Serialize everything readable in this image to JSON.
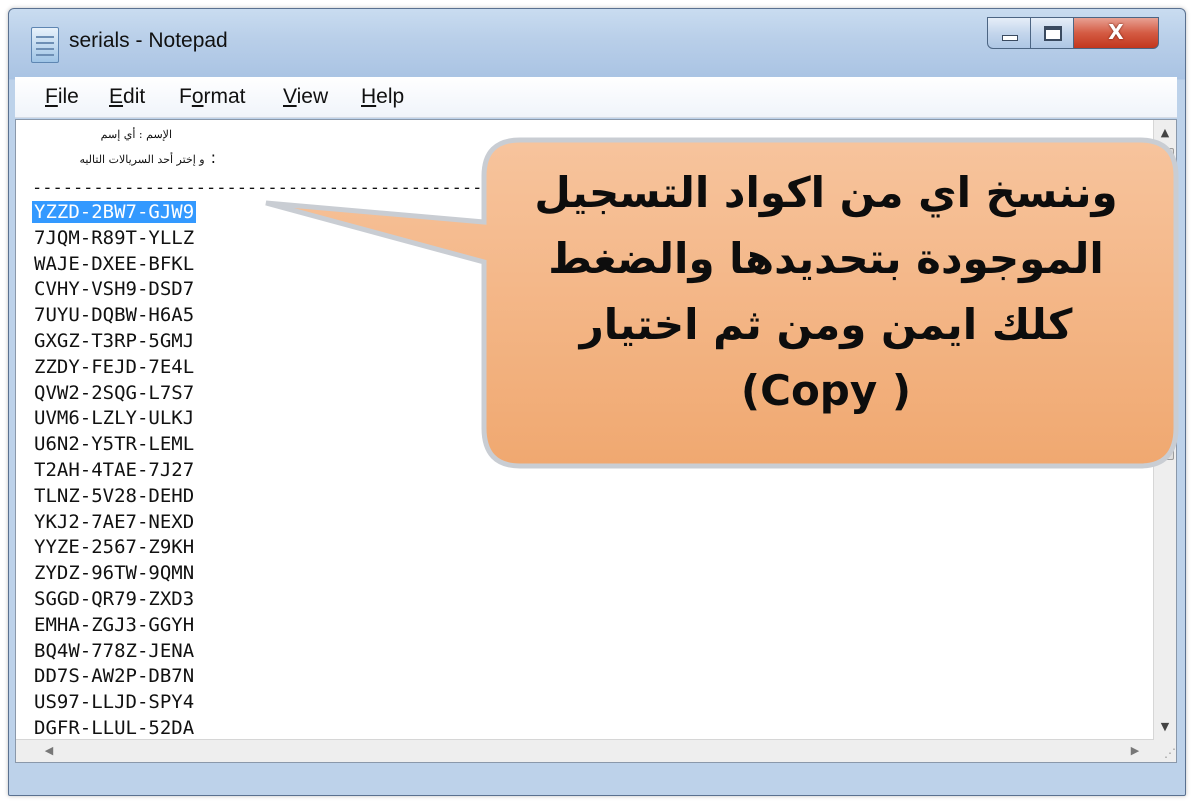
{
  "window": {
    "title": "serials - Notepad",
    "controls": {
      "minimize": "",
      "maximize": "",
      "close": "X"
    }
  },
  "menu": [
    {
      "first": "F",
      "rest": "ile"
    },
    {
      "first": "E",
      "rest": "dit"
    },
    {
      "pre": "F",
      "mid": "o",
      "post": "rmat"
    },
    {
      "first": "V",
      "rest": "iew"
    },
    {
      "first": "H",
      "rest": "elp"
    }
  ],
  "editor": {
    "hint_lines": [
      "الإسم : أي إسم",
      "و إختر أحد السريالات التاليه"
    ],
    "hint_colon": ":",
    "separator": "----------------------------------------------",
    "serials": [
      "YZZD-2BW7-GJW9",
      "7JQM-R89T-YLLZ",
      "WAJE-DXEE-BFKL",
      "CVHY-VSH9-DSD7",
      "7UYU-DQBW-H6A5",
      "GXGZ-T3RP-5GMJ",
      "ZZDY-FEJD-7E4L",
      "QVW2-2SQG-L7S7",
      "UVM6-LZLY-ULKJ",
      "U6N2-Y5TR-LEML",
      "T2AH-4TAE-7J27",
      "TLNZ-5V28-DEHD",
      "YKJ2-7AE7-NEXD",
      "YYZE-2567-Z9KH",
      "ZYDZ-96TW-9QMN",
      "SGGD-QR79-ZXD3",
      "EMHA-ZGJ3-GGYH",
      "BQ4W-778Z-JENA",
      "DD7S-AW2P-DB7N",
      "US97-LLJD-SPY4",
      "DGFR-LLUL-52DA"
    ],
    "selected_index": 0
  },
  "callout": {
    "lines": [
      "وننسخ اي من اكواد التسجيل",
      "الموجودة بتحديدها والضغط",
      "كلك ايمن ومن ثم اختيار",
      "(Copy )"
    ],
    "fill": "#f4b183",
    "stroke": "#c9cdd3"
  }
}
